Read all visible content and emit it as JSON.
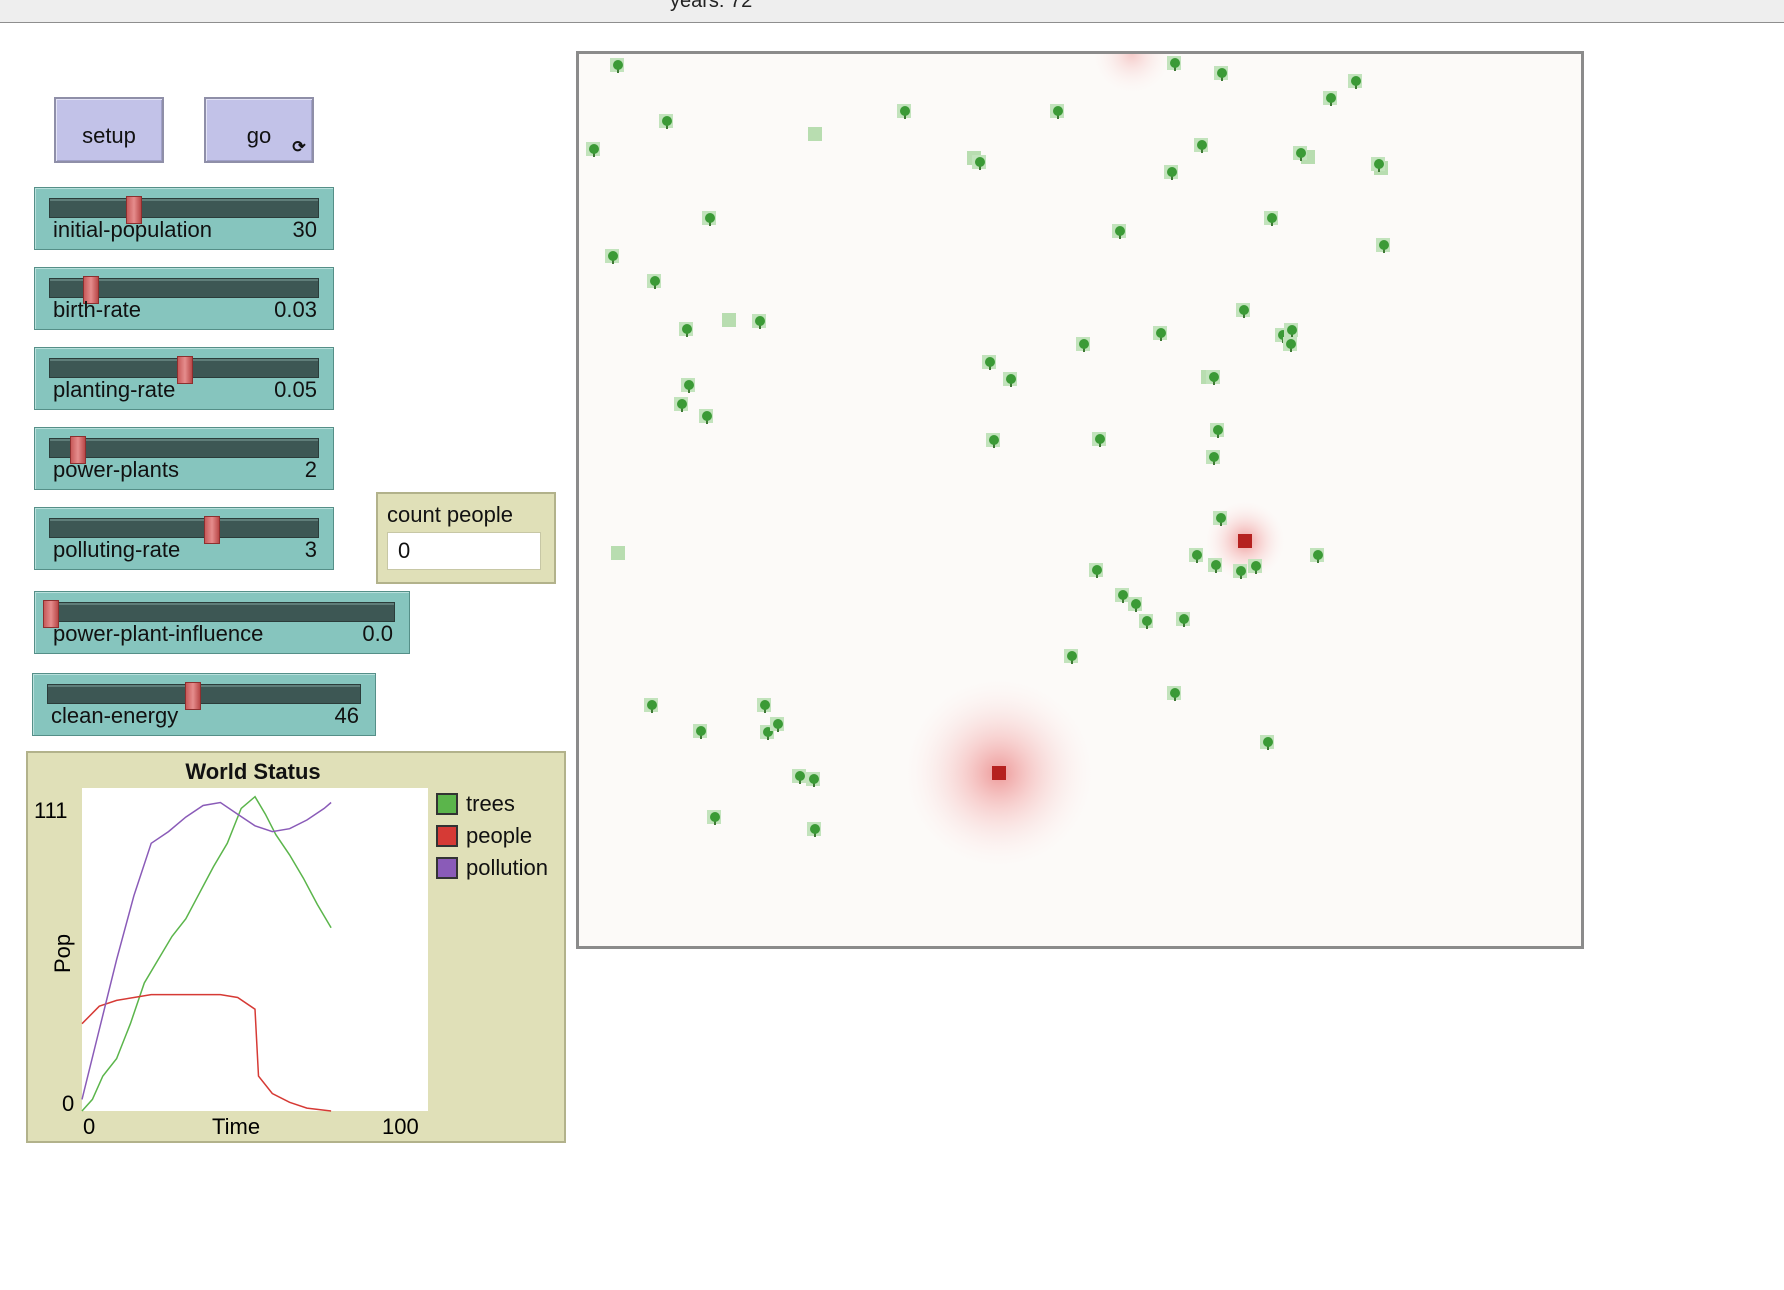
{
  "topbar": {
    "ticks_text": "years: 72"
  },
  "buttons": {
    "setup": "setup",
    "go": "go",
    "forever_icon": "cycle-icon"
  },
  "sliders": [
    {
      "name": "initial-population",
      "value": "30",
      "pos": 0.31
    },
    {
      "name": "birth-rate",
      "value": "0.03",
      "pos": 0.15
    },
    {
      "name": "planting-rate",
      "value": "0.05",
      "pos": 0.5
    },
    {
      "name": "power-plants",
      "value": "2",
      "pos": 0.1
    },
    {
      "name": "polluting-rate",
      "value": "3",
      "pos": 0.6
    },
    {
      "name": "power-plant-influence",
      "value": "0.0",
      "pos": 0.0
    },
    {
      "name": "clean-energy",
      "value": "46",
      "pos": 0.46
    }
  ],
  "monitor": {
    "title": "count people",
    "value": "0"
  },
  "plot": {
    "title": "World Status",
    "ylabel": "Pop",
    "xlabel": "Time",
    "ymin": "0",
    "ymax": "111",
    "xmin": "0",
    "xmax": "100",
    "legend": [
      {
        "name": "trees",
        "color": "#5bb54b"
      },
      {
        "name": "people",
        "color": "#d63a35"
      },
      {
        "name": "pollution",
        "color": "#8a5bb8"
      }
    ]
  },
  "chart_data": {
    "type": "line",
    "title": "World Status",
    "xlabel": "Time",
    "ylabel": "Pop",
    "xlim": [
      0,
      100
    ],
    "ylim": [
      0,
      111
    ],
    "series": [
      {
        "name": "trees",
        "values": [
          [
            0,
            0
          ],
          [
            3,
            4
          ],
          [
            6,
            12
          ],
          [
            10,
            18
          ],
          [
            14,
            30
          ],
          [
            18,
            44
          ],
          [
            22,
            52
          ],
          [
            26,
            60
          ],
          [
            30,
            66
          ],
          [
            34,
            75
          ],
          [
            38,
            84
          ],
          [
            42,
            92
          ],
          [
            46,
            104
          ],
          [
            50,
            108
          ],
          [
            53,
            102
          ],
          [
            56,
            95
          ],
          [
            60,
            88
          ],
          [
            64,
            80
          ],
          [
            68,
            71
          ],
          [
            72,
            63
          ]
        ]
      },
      {
        "name": "people",
        "values": [
          [
            0,
            30
          ],
          [
            5,
            36
          ],
          [
            10,
            38
          ],
          [
            15,
            39
          ],
          [
            20,
            40
          ],
          [
            25,
            40
          ],
          [
            30,
            40
          ],
          [
            35,
            40
          ],
          [
            40,
            40
          ],
          [
            45,
            39
          ],
          [
            50,
            35
          ],
          [
            51,
            12
          ],
          [
            55,
            6
          ],
          [
            60,
            3
          ],
          [
            65,
            1
          ],
          [
            72,
            0
          ]
        ]
      },
      {
        "name": "pollution",
        "values": [
          [
            0,
            4
          ],
          [
            5,
            28
          ],
          [
            10,
            52
          ],
          [
            15,
            74
          ],
          [
            20,
            92
          ],
          [
            25,
            96
          ],
          [
            30,
            101
          ],
          [
            35,
            105
          ],
          [
            40,
            106
          ],
          [
            45,
            102
          ],
          [
            50,
            98
          ],
          [
            55,
            96
          ],
          [
            60,
            97
          ],
          [
            65,
            100
          ],
          [
            70,
            104
          ],
          [
            72,
            106
          ]
        ]
      }
    ]
  },
  "world": {
    "trees": [
      [
        618,
        66
      ],
      [
        667,
        122
      ],
      [
        594,
        150
      ],
      [
        710,
        219
      ],
      [
        613,
        257
      ],
      [
        655,
        282
      ],
      [
        687,
        330
      ],
      [
        760,
        322
      ],
      [
        689,
        386
      ],
      [
        682,
        405
      ],
      [
        707,
        417
      ],
      [
        905,
        112
      ],
      [
        980,
        163
      ],
      [
        1058,
        112
      ],
      [
        1175,
        64
      ],
      [
        1222,
        74
      ],
      [
        1356,
        82
      ],
      [
        1331,
        99
      ],
      [
        1202,
        146
      ],
      [
        1301,
        154
      ],
      [
        1379,
        165
      ],
      [
        1172,
        173
      ],
      [
        1272,
        219
      ],
      [
        1120,
        232
      ],
      [
        1244,
        311
      ],
      [
        1161,
        334
      ],
      [
        1084,
        345
      ],
      [
        1283,
        336
      ],
      [
        1292,
        331
      ],
      [
        1291,
        345
      ],
      [
        990,
        363
      ],
      [
        1011,
        380
      ],
      [
        1214,
        378
      ],
      [
        994,
        441
      ],
      [
        1100,
        440
      ],
      [
        1218,
        431
      ],
      [
        1214,
        458
      ],
      [
        1221,
        519
      ],
      [
        1197,
        556
      ],
      [
        1216,
        566
      ],
      [
        1241,
        572
      ],
      [
        1256,
        567
      ],
      [
        1318,
        556
      ],
      [
        1097,
        571
      ],
      [
        1123,
        596
      ],
      [
        1136,
        605
      ],
      [
        1147,
        622
      ],
      [
        1184,
        620
      ],
      [
        1072,
        657
      ],
      [
        1175,
        694
      ],
      [
        1268,
        743
      ],
      [
        543,
        706
      ],
      [
        652,
        706
      ],
      [
        765,
        706
      ],
      [
        701,
        732
      ],
      [
        768,
        733
      ],
      [
        778,
        725
      ],
      [
        800,
        777
      ],
      [
        814,
        780
      ],
      [
        545,
        800
      ],
      [
        715,
        818
      ],
      [
        815,
        830
      ],
      [
        523,
        624
      ],
      [
        1384,
        246
      ]
    ],
    "lightpatches": [
      [
        815,
        134
      ],
      [
        729,
        320
      ],
      [
        618,
        553
      ],
      [
        974,
        158
      ],
      [
        1208,
        377
      ],
      [
        1308,
        157
      ],
      [
        1381,
        168
      ]
    ],
    "plants": [
      [
        1245,
        541
      ],
      [
        999,
        773
      ]
    ]
  }
}
